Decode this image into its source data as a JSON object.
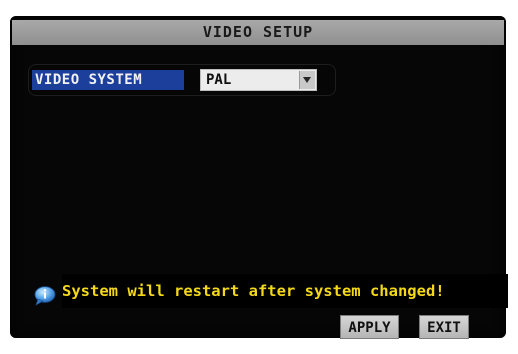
{
  "dialog": {
    "title": "VIDEO SETUP"
  },
  "settings": {
    "video_system": {
      "label": "VIDEO SYSTEM",
      "value": "PAL"
    }
  },
  "notice": {
    "icon": "info-bubble-icon",
    "text": "System will restart after system changed!",
    "color": "#f4d81a"
  },
  "buttons": {
    "apply": "APPLY",
    "exit": "EXIT"
  },
  "colors": {
    "label_highlight": "#1c3f9c",
    "title_bar": "#9f9f9f"
  }
}
